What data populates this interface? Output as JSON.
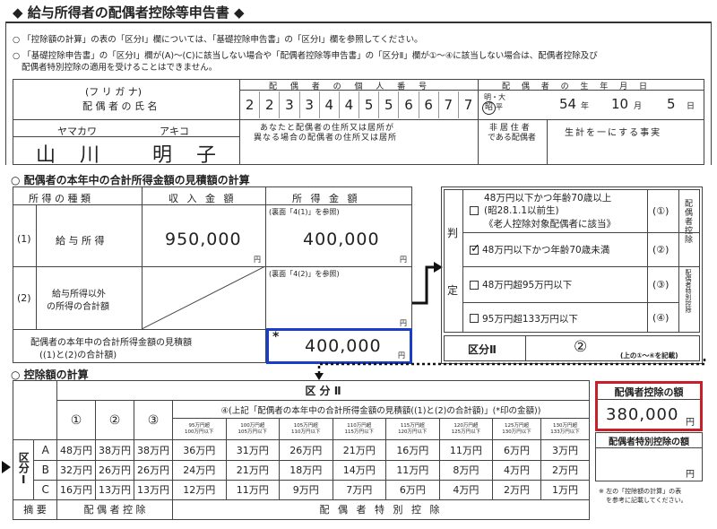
{
  "title": "◆ 給与所得者の配偶者控除等申告書 ◆",
  "notes": [
    "○ 「控除額の計算」の表の「区分Ⅰ」欄については、「基礎控除申告書」の「区分Ⅰ」欄を参照してください。",
    "○ 「基礎控除申告書」の「区分Ⅰ」欄が(A)～(C)に該当しない場合や「配偶者控除等申告書」の「区分Ⅱ」欄が①～④に該当しない場合は、配偶者控除及び",
    "配偶者特別控除の適用を受けることはできません。"
  ],
  "spouse": {
    "furigana_label": "(フ リ ガ ナ)",
    "name_label": "配 偶 者 の 氏 名",
    "kana_family": "ヤマカワ",
    "kana_given": "アキコ",
    "family_name": "山 川",
    "given_name": "明 子",
    "mynumber_label": "配 偶 者 の 個 人 番 号",
    "mynumber": [
      "2",
      "2",
      "3",
      "3",
      "4",
      "4",
      "5",
      "5",
      "6",
      "6",
      "7",
      "7"
    ],
    "address_label1": "あなたと配偶者の住所又は居所が",
    "address_label2": "異なる場合の配偶者の住所又は居所",
    "birth_label": "配 偶 者 の 生 年 月 日",
    "era_top": "明・大",
    "era_selected": "昭",
    "era_bottom": "平",
    "birth_year": "54",
    "year_unit": "年",
    "birth_month": "10",
    "month_unit": "月",
    "birth_day": "5",
    "day_unit": "日",
    "nonresident_label1": "非 居 住 者",
    "nonresident_label2": "である配偶者",
    "support_label": "生計を一にする事実"
  },
  "income_section": {
    "heading": "○ 配偶者の本年中の合計所得金額の見積額の計算",
    "col_type": "所 得 の 種 類",
    "col_revenue": "収 入 金 額",
    "col_income": "所 得 金 額",
    "row1_num": "(1)",
    "row1_label": "給 与 所 得",
    "row1_revenue": "950,000",
    "yen": "円",
    "row1_ref": "(裏面「4(1)」を参照)",
    "row1_income": "400,000",
    "row2_num": "(2)",
    "row2_label1": "給与所得以外",
    "row2_label2": "の所得の合計額",
    "row2_ref": "(裏面「4(2)」を参照)",
    "total_label1": "配偶者の本年中の合計所得金額の見積額",
    "total_label2": "((1)と(2)の合計額)",
    "total_mark": "*",
    "total_value": "400,000"
  },
  "judgment": {
    "label_top": "判",
    "label_bottom": "定",
    "items": [
      {
        "line1": "48万円以下かつ年齢70歳以上",
        "line2": "(昭28.1.1以前生)",
        "line3": "《老人控除対象配偶者に該当》",
        "num": "(①)",
        "checked": false
      },
      {
        "line1": "48万円以下かつ年齢70歳未満",
        "num": "(②)",
        "checked": true
      },
      {
        "line1": "48万円超95万円以下",
        "num": "(③)",
        "checked": false
      },
      {
        "line1": "95万円超133万円以下",
        "num": "(④)",
        "checked": false
      }
    ],
    "side_top": "配偶者控除",
    "side_bottom": "配偶者特別控除",
    "kubun_label": "区分Ⅱ",
    "kubun_value": "②",
    "kubun_note": "(上の①～④を記載)"
  },
  "calc": {
    "heading": "○ 控除額の計算",
    "kubun2_header": "区 分 Ⅱ",
    "col_headers": [
      "①",
      "②",
      "③"
    ],
    "col4_header": "④(上記「配偶者の本年中の合計所得金額の見積額((1)と(2)の合計額)」(*印の金額))",
    "sub_ranges": [
      [
        "95万円超",
        "100万円以下"
      ],
      [
        "100万円超",
        "105万円以下"
      ],
      [
        "105万円超",
        "110万円以下"
      ],
      [
        "110万円超",
        "115万円以下"
      ],
      [
        "115万円超",
        "120万円以下"
      ],
      [
        "120万円超",
        "125万円以下"
      ],
      [
        "125万円超",
        "130万円以下"
      ],
      [
        "130万円超",
        "133万円以下"
      ]
    ],
    "kubun1_label": "区分Ⅰ",
    "rows": [
      {
        "key": "A",
        "cells": [
          "48万円",
          "38万円",
          "38万円",
          "36万円",
          "31万円",
          "26万円",
          "21万円",
          "16万円",
          "11万円",
          "6万円",
          "3万円"
        ]
      },
      {
        "key": "B",
        "cells": [
          "32万円",
          "26万円",
          "26万円",
          "24万円",
          "21万円",
          "18万円",
          "14万円",
          "11万円",
          "8万円",
          "4万円",
          "2万円"
        ]
      },
      {
        "key": "C",
        "cells": [
          "16万円",
          "13万円",
          "13万円",
          "12万円",
          "11万円",
          "9万円",
          "7万円",
          "6万円",
          "4万円",
          "2万円",
          "1万円"
        ]
      }
    ],
    "summary_label": "摘 要",
    "summary_spouse": "配 偶 者 控 除",
    "summary_special": "配 偶 者 特 別 控 除"
  },
  "deduction": {
    "spouse_label": "配偶者控除の額",
    "spouse_value": "380,000",
    "special_label": "配偶者特別控除の額",
    "special_value": "",
    "yen": "円",
    "note1": "※ 左の「控除額の計算」の表",
    "note2": "を参考に記載してください。"
  },
  "colors": {
    "blue_box": "#1a3ec7",
    "red_box": "#c8202a"
  }
}
